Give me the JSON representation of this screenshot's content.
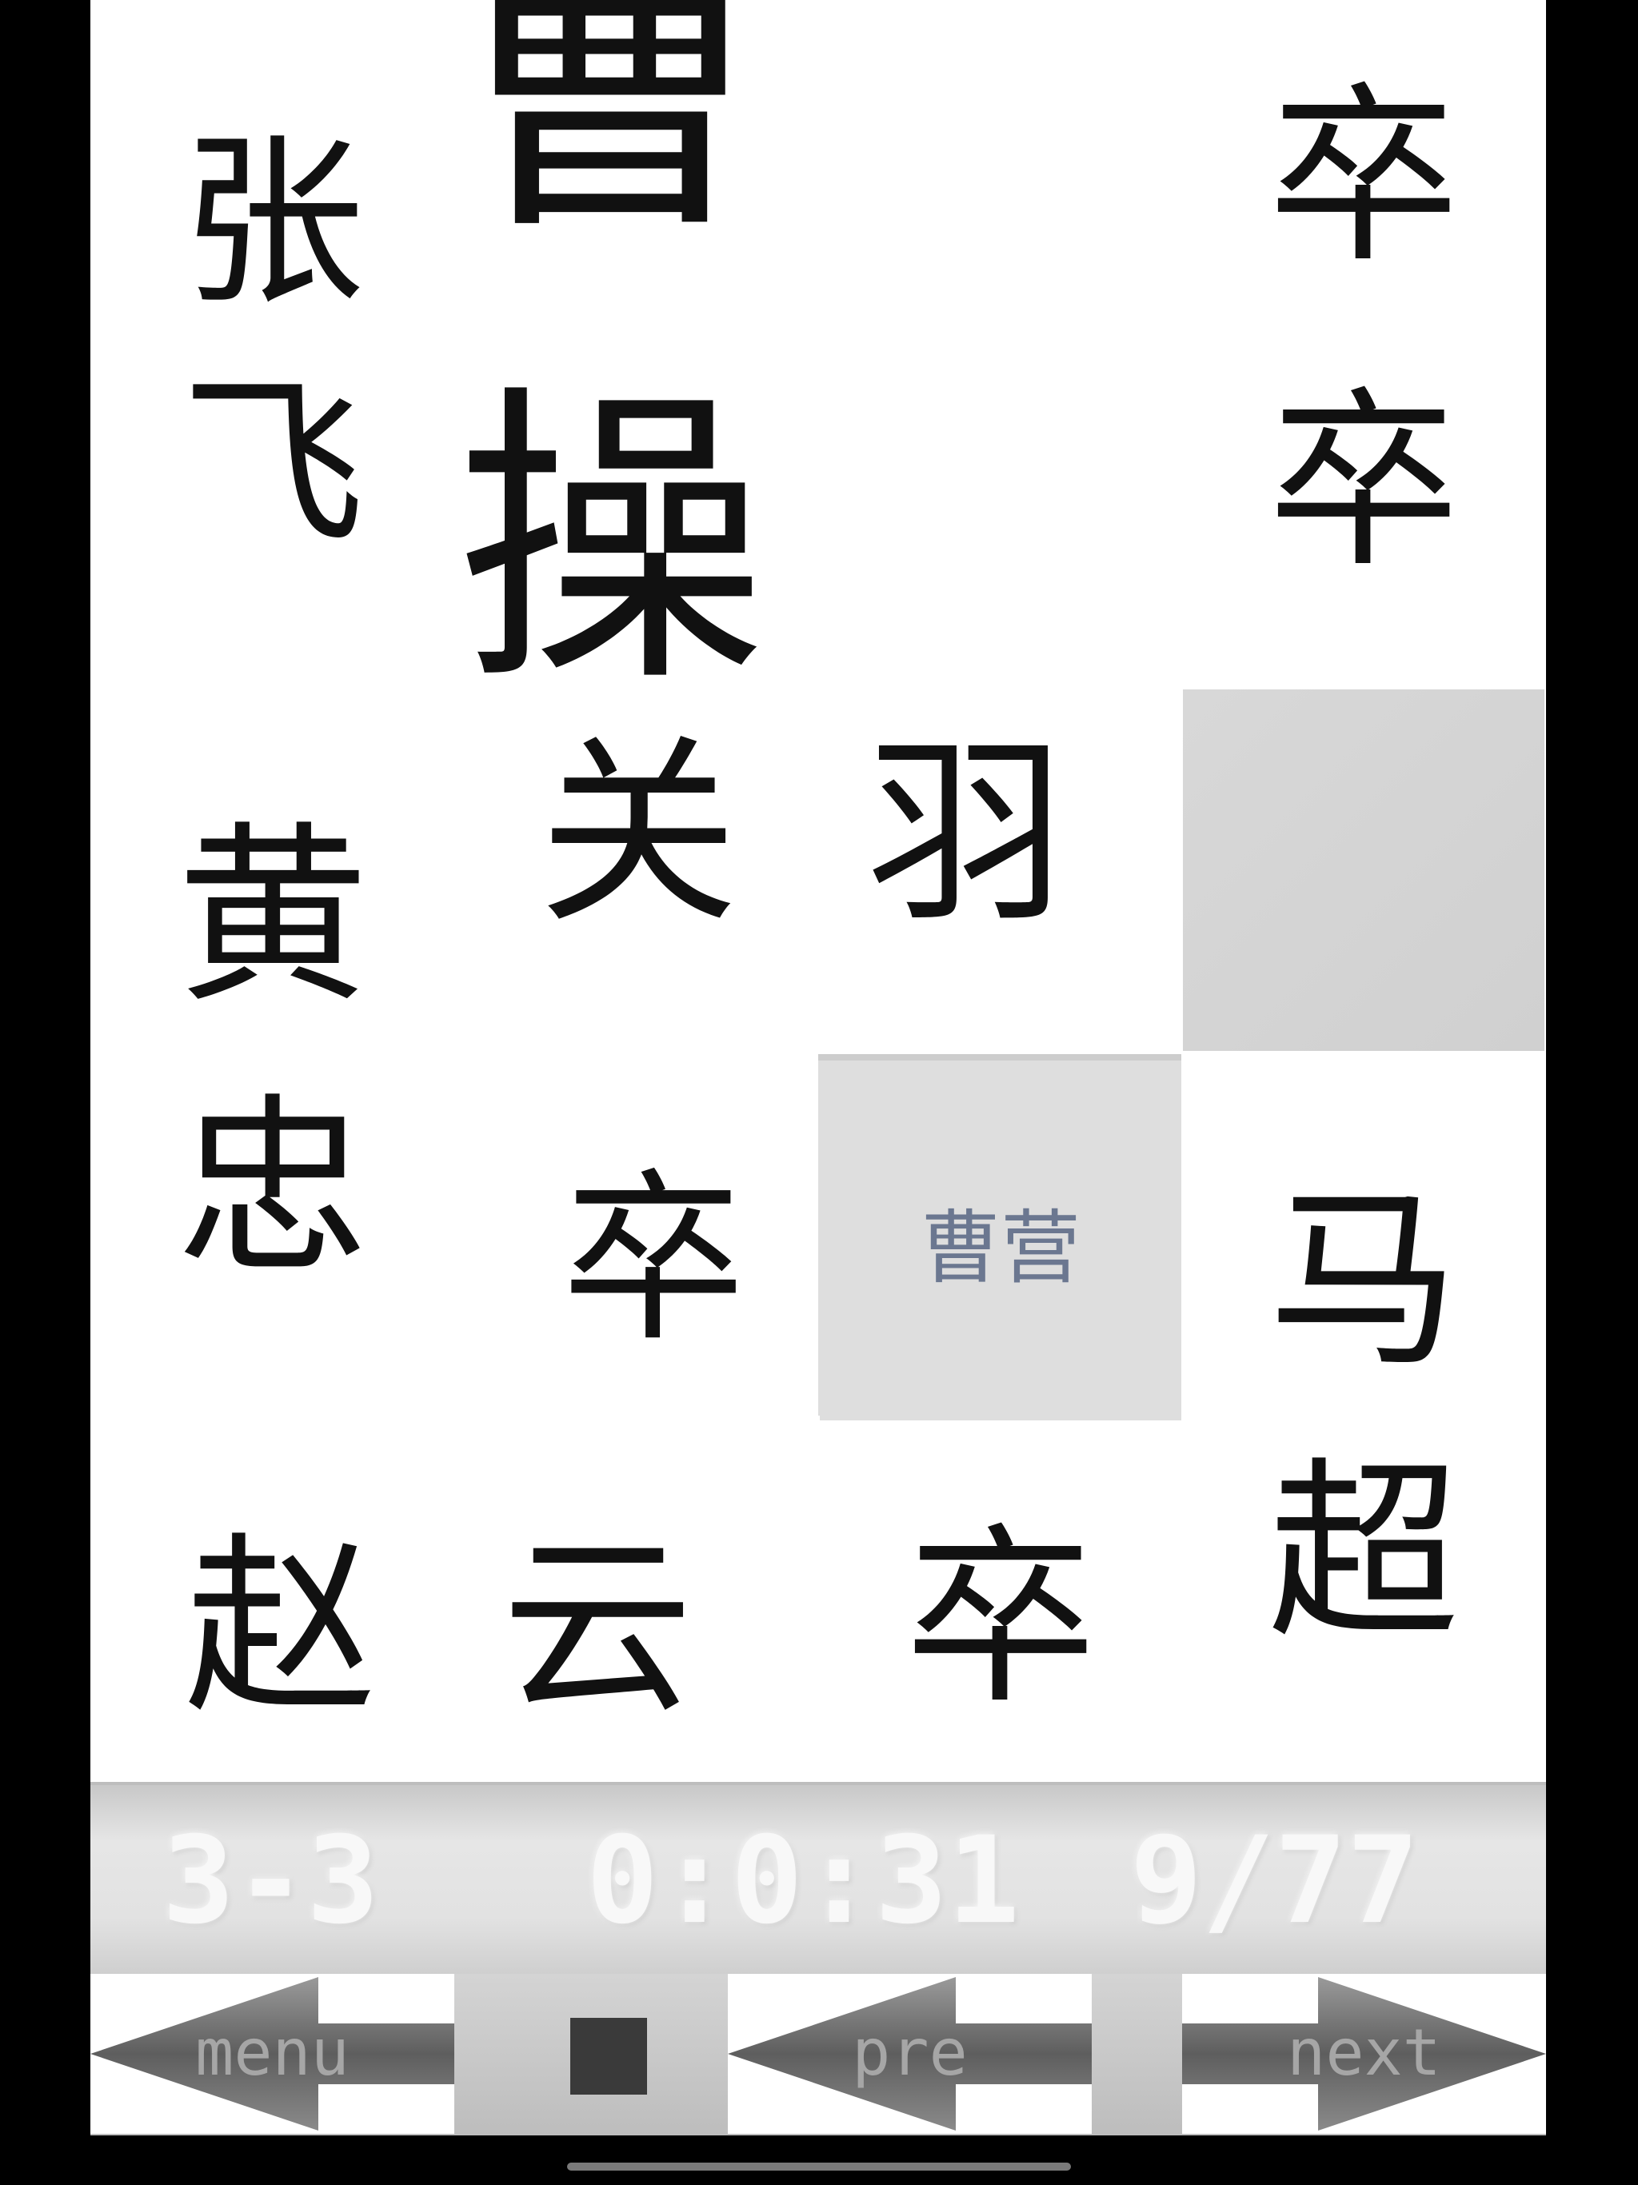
{
  "board": {
    "pieces": {
      "zhangfei": [
        "张",
        "飞"
      ],
      "caocao": "曹 操",
      "soldier": "卒",
      "huangzhong": [
        "黄",
        "忠"
      ],
      "guanyu": "关 羽",
      "exit": "曹营",
      "machao": [
        "马",
        "超"
      ],
      "zhaoyun": "赵 云"
    }
  },
  "status": {
    "level": "3-3",
    "timer": "0:0:31",
    "moves": "9/77"
  },
  "controls": {
    "menu_label": "menu",
    "prev_label": "pre",
    "next_label": "next"
  },
  "icons": {
    "back": "left-arrow-icon",
    "forward": "right-arrow-icon",
    "stop": "stop-icon"
  },
  "colors": {
    "board": "#ffffff",
    "empty": "#d6d6d6",
    "exit_text": "#6b7790",
    "arrow": "#6e6e6e",
    "stop": "#3a3a3a"
  }
}
